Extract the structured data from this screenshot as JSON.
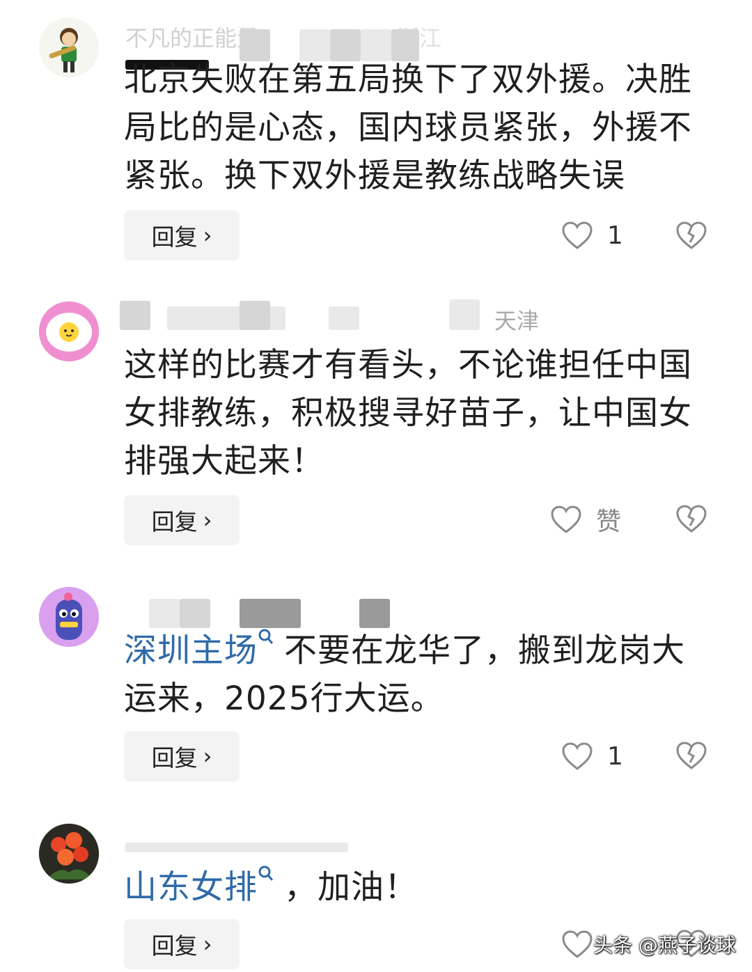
{
  "comments": [
    {
      "user_visible": "不凡的正能量",
      "location": "浙江",
      "text": "北京失败在第五局换下了双外援。决胜局比的是心态，国内球员紧张，外援不紧张。换下双外援是教练战略失误",
      "reply_label": "回复",
      "like_count": "1"
    },
    {
      "location": "天津",
      "text": "这样的比赛才有看头，不论谁担任中国女排教练，积极搜寻好苗子，让中国女排强大起来！",
      "reply_label": "回复",
      "like_count": "赞"
    },
    {
      "link_text": "深圳主场",
      "text": "不要在龙华了，搬到龙岗大运来，2025行大运。",
      "reply_label": "回复",
      "like_count": "1"
    },
    {
      "link_text": "山东女排",
      "text": "，加油！",
      "reply_label": "回复"
    }
  ],
  "watermark": "头条 @燕子谈球",
  "colors": {
    "link": "#2f6aa8",
    "reply_bg": "#f3f3f3",
    "icon": "#8a8a8a"
  },
  "icons": [
    "search-icon",
    "heart-icon",
    "broken-heart-icon",
    "chevron-right-icon"
  ]
}
